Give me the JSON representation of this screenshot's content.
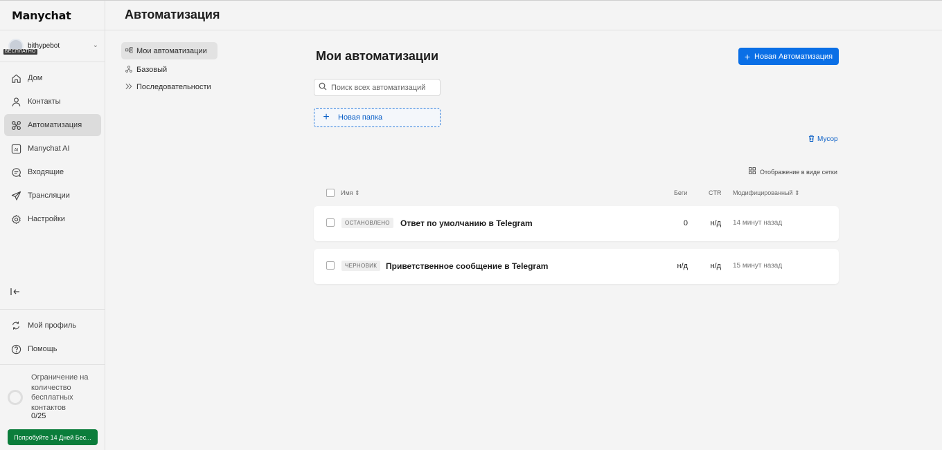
{
  "app": {
    "logo": "Manychat"
  },
  "header": {
    "title": "Автоматизация"
  },
  "account": {
    "name": "bithypebot",
    "badge": "БЕСПЛАТНО"
  },
  "sidebar": {
    "items": [
      {
        "label": "Дом",
        "icon": "home-icon"
      },
      {
        "label": "Контакты",
        "icon": "person-icon"
      },
      {
        "label": "Автоматизация",
        "icon": "automation-icon",
        "active": true
      },
      {
        "label": "Manychat AI",
        "icon": "ai-icon"
      },
      {
        "label": "Входящие",
        "icon": "chat-icon"
      },
      {
        "label": "Трансляции",
        "icon": "send-icon"
      },
      {
        "label": "Настройки",
        "icon": "gear-icon"
      }
    ],
    "bottom": [
      {
        "label": "Мой профиль",
        "icon": "refresh-icon"
      },
      {
        "label": "Помощь",
        "icon": "help-icon"
      }
    ],
    "limit_text": "Ограничение на количество бесплатных контактов",
    "limit_count": "0/25",
    "trial_button": "Попробуйте 14 Дней Бес..."
  },
  "subnav": [
    {
      "label": "Мои автоматизации",
      "icon": "flow-icon",
      "active": true
    },
    {
      "label": "Базовый",
      "icon": "tree-icon"
    },
    {
      "label": "Последовательности",
      "icon": "sequence-icon"
    }
  ],
  "main": {
    "title": "Мои автоматизации",
    "new_button": "Новая Автоматизация",
    "search_placeholder": "Поиск всех автоматизаций",
    "new_folder": "Новая папка",
    "trash": "Мусор",
    "grid_view": "Отображение в виде сетки",
    "columns": {
      "name": "Имя",
      "runs": "Беги",
      "ctr": "CTR",
      "modified": "Модифицированный"
    },
    "rows": [
      {
        "status": "ОСТАНОВЛЕНО",
        "name": "Ответ по умолчанию в Telegram",
        "runs": "0",
        "ctr": "н/д",
        "modified": "14 минут назад"
      },
      {
        "status": "ЧЕРНОВИК",
        "name": "Приветственное сообщение в Telegram",
        "runs": "н/д",
        "ctr": "н/д",
        "modified": "15 минут назад"
      }
    ]
  }
}
